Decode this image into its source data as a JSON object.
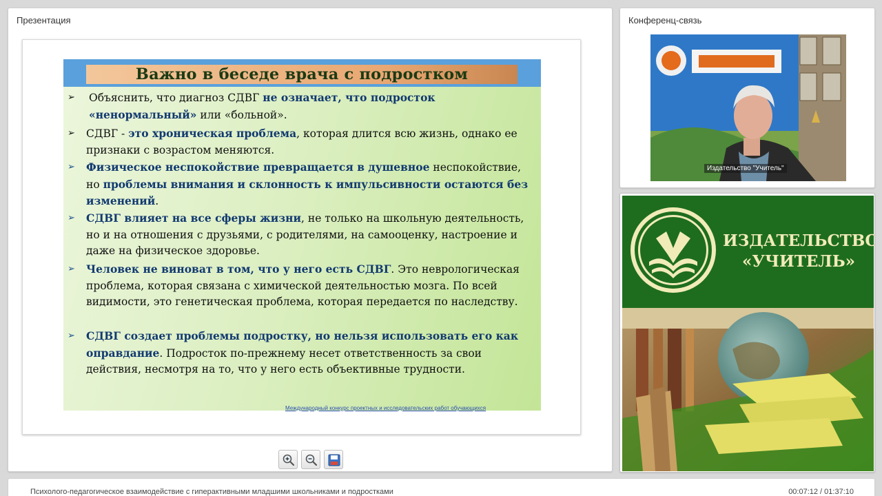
{
  "presentation_panel": {
    "title": "Презентация"
  },
  "slide": {
    "title": "Важно в беседе врача с подростком",
    "bullets": [
      [
        {
          "t": "Объяснить, что диагноз СДВГ ",
          "h": false
        },
        {
          "t": "не означает, что подросток «ненормальный»",
          "h": true
        },
        {
          "t": " или «больной».",
          "h": false
        }
      ],
      [
        {
          "t": "СДВГ - ",
          "h": false
        },
        {
          "t": "это хроническая проблема",
          "h": true
        },
        {
          "t": ", которая длится всю жизнь, однако ее признаки с возрастом меняются.",
          "h": false
        }
      ],
      [
        {
          "t": "Физическое неспокойствие превращается в душевное",
          "h": true
        },
        {
          "t": " неспокойствие,  но ",
          "h": false
        },
        {
          "t": "проблемы внимания и склонность к импульсивности остаются без изменений",
          "h": true
        },
        {
          "t": ".",
          "h": false
        }
      ],
      [
        {
          "t": "СДВГ влияет на все сферы жизни",
          "h": true
        },
        {
          "t": ", не только на школьную деятельность, но и на отношения с друзьями, с родителями, на самооценку, настроение и даже на физическое здоровье.",
          "h": false
        }
      ],
      [
        {
          "t": "Человек не виноват в том, что у него есть СДВГ",
          "h": true
        },
        {
          "t": ". Это неврологическая проблема, которая связана с химической деятельностью мозга. По всей видимости, это генетическая проблема, которая передается по наследству.",
          "h": false
        }
      ],
      [
        {
          "t": "СДВГ создает проблемы подростку, но нельзя использовать его как оправдание",
          "h": true
        },
        {
          "t": ". Подросток по-прежнему несет ответственность за свои действия, несмотря на то, что у него есть объективные трудности.",
          "h": false
        }
      ]
    ],
    "footer_link": "Международный конкурс проектных и исследовательских работ обучающихся"
  },
  "toolbar": {
    "zoom_in_icon": "zoom-in-icon",
    "zoom_out_icon": "zoom-out-icon",
    "save_icon": "save-icon"
  },
  "conference_panel": {
    "title": "Конференц-связь",
    "video_caption": "Издательство \"Учитель\""
  },
  "publisher": {
    "name_line1": "ИЗДАТЕЛЬСТВО",
    "name_line2": "«УЧИТЕЛЬ»",
    "logo_icon": "publisher-logo-icon"
  },
  "footer": {
    "title": "Психолого-педагогическое взаимодействие с гиперактивными младшими школьниками и подростками",
    "time": "00:07:12 / 01:37:10"
  },
  "colors": {
    "slide_header": "#5aa0dc",
    "highlight_text": "#123a70",
    "publisher_green": "#1e6d1e"
  }
}
